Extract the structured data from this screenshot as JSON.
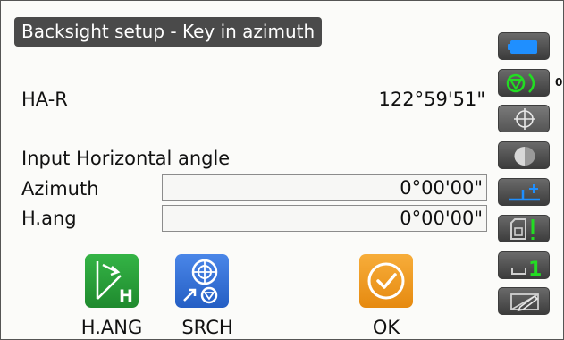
{
  "title": "Backsight setup - Key in azimuth",
  "ha_r": {
    "label": "HA-R",
    "value": "122°59'51\""
  },
  "input_heading": "Input Horizontal angle",
  "azimuth": {
    "label": "Azimuth",
    "value": "0°00'00\""
  },
  "h_ang": {
    "label": "H.ang",
    "value": "0°00'00\""
  },
  "softkeys": [
    {
      "label": "H.ANG",
      "icon": "h-ang-icon",
      "color": "#2e9e3e"
    },
    {
      "label": "SRCH",
      "icon": "search-target-icon",
      "color": "#2f6fd6"
    },
    {
      "label": "OK",
      "icon": "checkmark-icon",
      "color": "#f09a1e"
    }
  ],
  "sidebar": {
    "prism_constant": "0",
    "face_indicator": "1",
    "icons": [
      "battery-icon",
      "target-prism-icon",
      "tilt-icon",
      "laser-icon",
      "offset-icon",
      "sd-card-icon",
      "face-icon",
      "input-mode-icon"
    ]
  },
  "colors": {
    "title_bg": "#4a4a4a",
    "accent_blue": "#1f8fff",
    "accent_green": "#22dd22"
  }
}
